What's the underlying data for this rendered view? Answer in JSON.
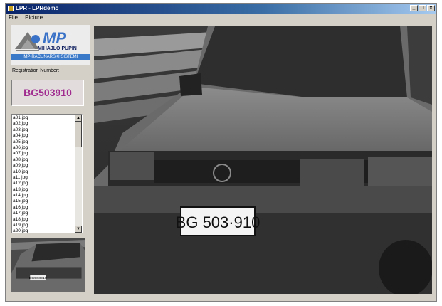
{
  "window": {
    "title": "LPR - LPRdemo",
    "minimize": "_",
    "maximize": "□",
    "close": "x"
  },
  "menu": [
    {
      "label": "File"
    },
    {
      "label": "Picture"
    }
  ],
  "logo": {
    "mark": "MP",
    "name": "MIHAJLO PUPIN",
    "subtitle": "IMP-RAČUNARSKI SISTEMI"
  },
  "registration": {
    "label": "Registration Number:",
    "value": "BG503910"
  },
  "files": [
    "a01.jpg",
    "a02.jpg",
    "a03.jpg",
    "a04.jpg",
    "a05.jpg",
    "a06.jpg",
    "a07.jpg",
    "a08.jpg",
    "a09.jpg",
    "a10.jpg",
    "a11.jpg",
    "a12.jpg",
    "a13.jpg",
    "a14.jpg",
    "a15.jpg",
    "a16.jpg",
    "a17.jpg",
    "a18.jpg",
    "a19.jpg",
    "a20.jpg"
  ],
  "main_image": {
    "plate": "BG 503·910"
  },
  "thumbnail": {
    "plate": "BG503910"
  },
  "colors": {
    "accent": "#a02c90",
    "titlebar": "#0a246a",
    "logo": "#3a72c8"
  }
}
